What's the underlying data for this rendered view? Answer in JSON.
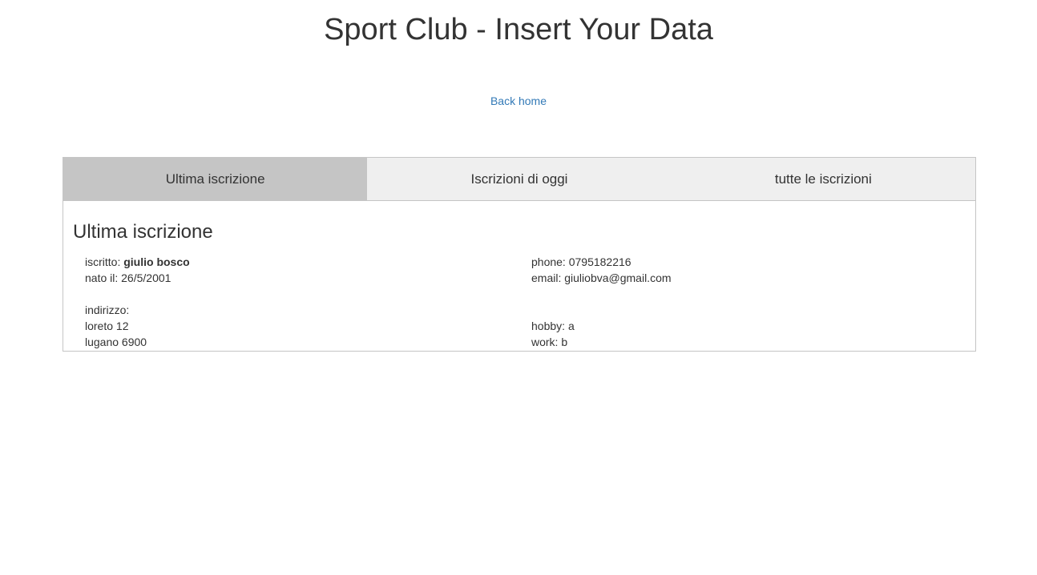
{
  "header": {
    "title": "Sport Club - Insert Your Data",
    "back_link": "Back home"
  },
  "tabs": [
    {
      "label": "Ultima iscrizione",
      "active": true
    },
    {
      "label": "Iscrizioni di oggi",
      "active": false
    },
    {
      "label": "tutte le iscrizioni",
      "active": false
    }
  ],
  "section": {
    "title": "Ultima iscrizione"
  },
  "registration": {
    "iscritto_label": "iscritto:",
    "iscritto_value": "giulio bosco",
    "nato_label": "nato il:",
    "nato_value": "26/5/2001",
    "indirizzo_label": "indirizzo:",
    "street": "loreto 12",
    "city": "lugano 6900",
    "phone_label": "phone:",
    "phone_value": "0795182216",
    "email_label": "email:",
    "email_value": "giuliobva@gmail.com",
    "hobby_label": "hobby:",
    "hobby_value": "a",
    "work_label": "work:",
    "work_value": "b"
  },
  "colors": {
    "link": "#337ab7",
    "active_tab": "#c5c5c5",
    "inactive_tab": "#efefef",
    "border": "#c5c5c5",
    "text": "#333333"
  }
}
